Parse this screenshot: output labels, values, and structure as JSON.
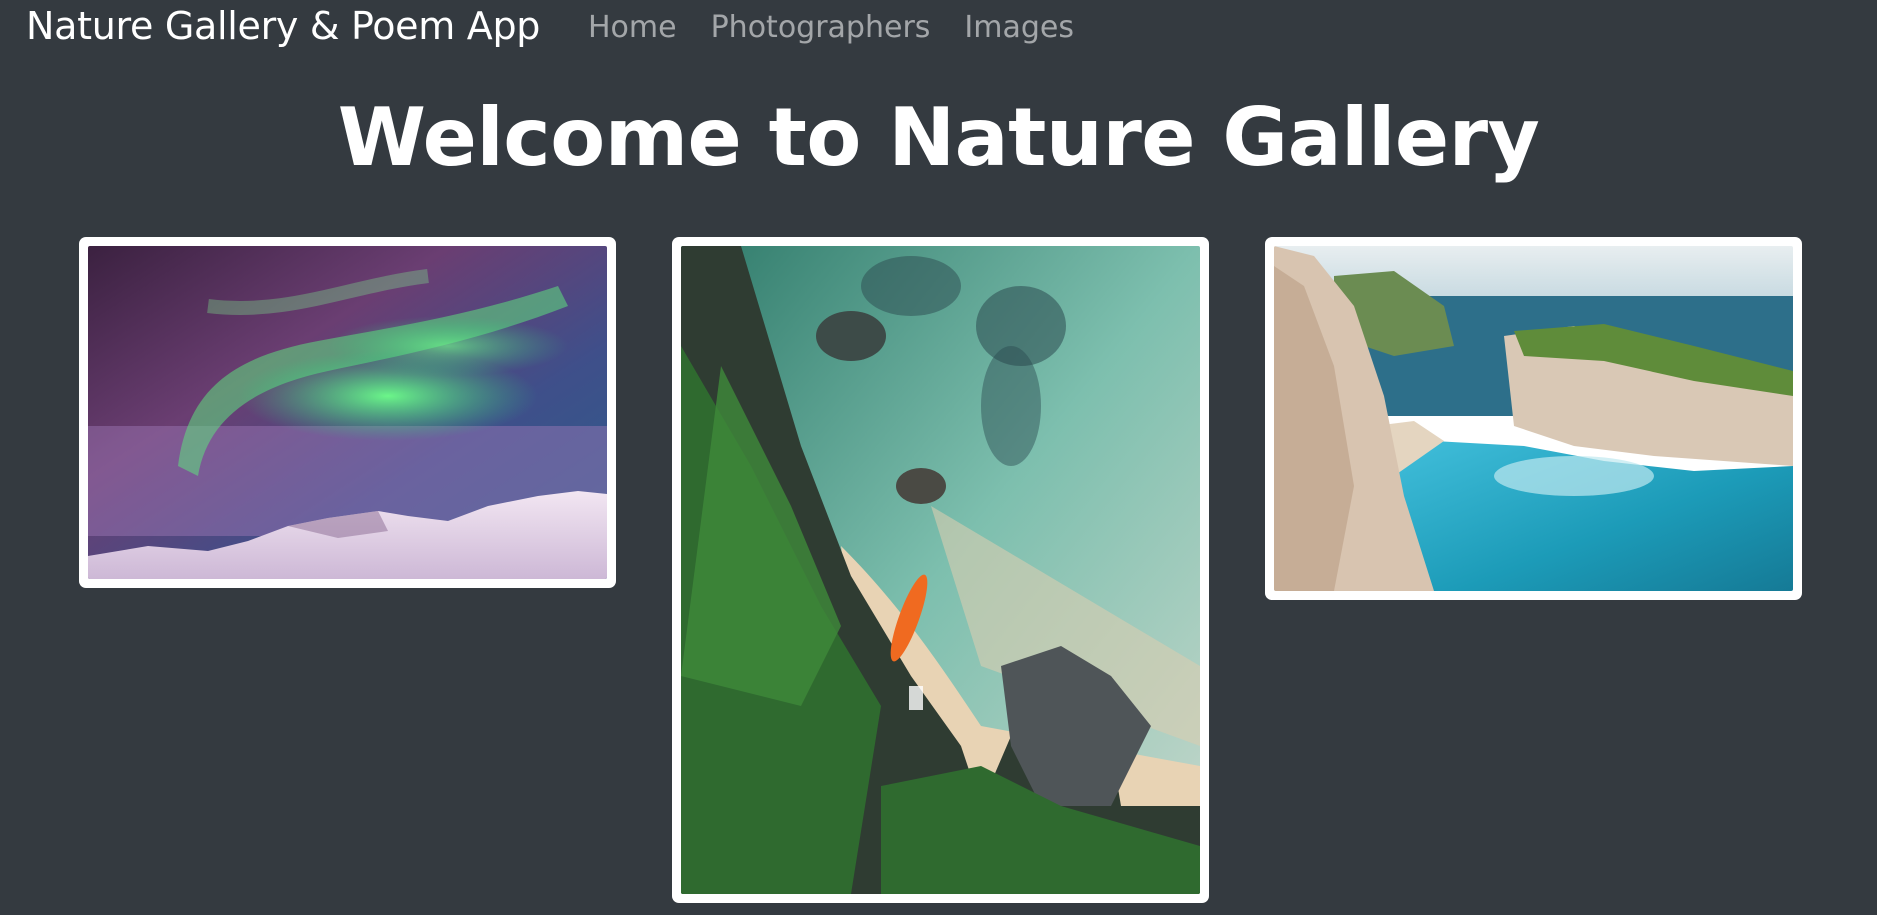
{
  "navbar": {
    "brand": "Nature Gallery & Poem App",
    "links": [
      {
        "label": "Home"
      },
      {
        "label": "Photographers"
      },
      {
        "label": "Images"
      }
    ]
  },
  "main": {
    "title": "Welcome to Nature Gallery"
  },
  "gallery": {
    "images": [
      {
        "subject": "aurora borealis over snowy mountains"
      },
      {
        "subject": "aerial beach with kayak and rocks"
      },
      {
        "subject": "cove with turquoise water and cliffs"
      }
    ]
  },
  "colors": {
    "background": "#343a40",
    "nav_text_muted": "#9a9da1",
    "card_border": "#ffffff"
  }
}
